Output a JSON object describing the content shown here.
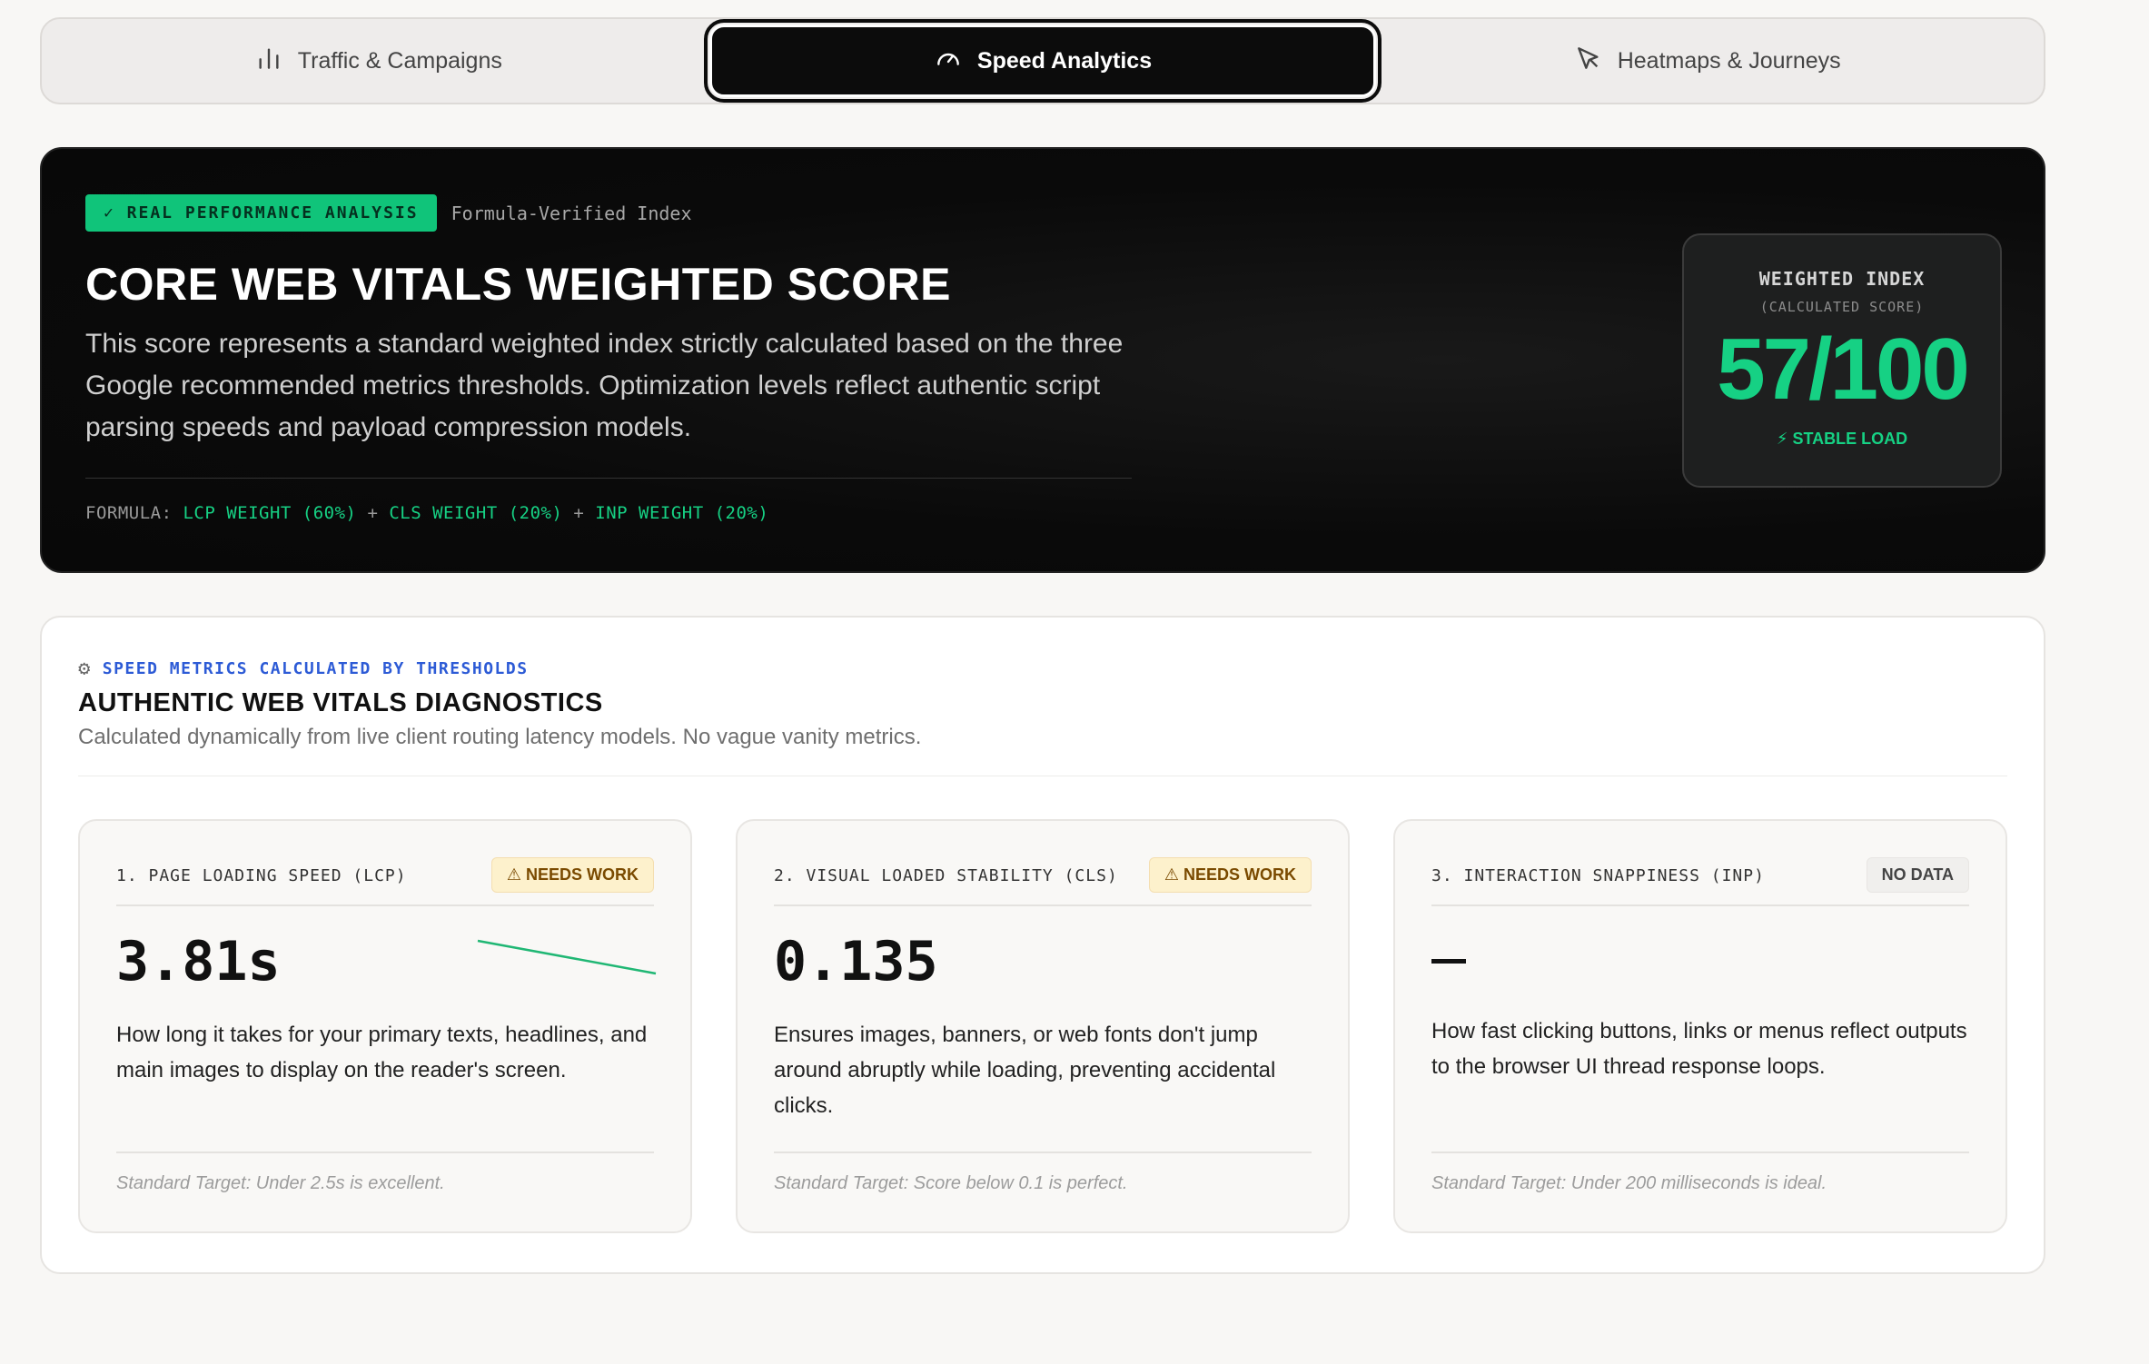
{
  "tabs": [
    {
      "label": "Traffic & Campaigns",
      "icon": "bar-chart-icon",
      "active": false
    },
    {
      "label": "Speed Analytics",
      "icon": "gauge-icon",
      "active": true
    },
    {
      "label": "Heatmaps & Journeys",
      "icon": "cursor-icon",
      "active": false
    }
  ],
  "hero": {
    "badge": "✓ REAL PERFORMANCE ANALYSIS",
    "badge_note": "Formula-Verified Index",
    "title": "CORE WEB VITALS WEIGHTED SCORE",
    "description": "This score represents a standard weighted index strictly calculated based on the three Google recommended metrics thresholds. Optimization levels reflect authentic script parsing speeds and payload compression models.",
    "formula_prefix": "FORMULA:",
    "formula_lcp": "LCP WEIGHT (60%)",
    "formula_plus1": "+",
    "formula_cls": "CLS WEIGHT (20%)",
    "formula_plus2": "+",
    "formula_inp": "INP WEIGHT (20%)",
    "score": {
      "label": "WEIGHTED INDEX",
      "sublabel": "(CALCULATED SCORE)",
      "value": "57/100",
      "status": "⚡ STABLE LOAD"
    }
  },
  "diagnostics": {
    "kicker": "SPEED METRICS CALCULATED BY THRESHOLDS",
    "title": "AUTHENTIC WEB VITALS DIAGNOSTICS",
    "subtitle": "Calculated dynamically from live client routing latency models. No vague vanity metrics.",
    "cards": [
      {
        "label": "1. PAGE LOADING SPEED (LCP)",
        "badge": "⚠ NEEDS WORK",
        "value": "3.81s",
        "description": "How long it takes for your primary texts, headlines, and main images to display on the reader's screen.",
        "target": "Standard Target: Under 2.5s is excellent."
      },
      {
        "label": "2. VISUAL LOADED STABILITY (CLS)",
        "badge": "⚠ NEEDS WORK",
        "value": "0.135",
        "description": "Ensures images, banners, or web fonts don't jump around abruptly while loading, preventing accidental clicks.",
        "target": "Standard Target: Score below 0.1 is perfect."
      },
      {
        "label": "3. INTERACTION SNAPPINESS (INP)",
        "badge": "NO DATA",
        "value": "",
        "description": "How fast clicking buttons, links or menus reflect outputs to the browser UI thread response loops.",
        "target": "Standard Target: Under 200 milliseconds is ideal."
      }
    ]
  },
  "colors": {
    "accent_green": "#16d184",
    "warning_bg": "#fdf1cc",
    "link_blue": "#2d5bd6"
  }
}
